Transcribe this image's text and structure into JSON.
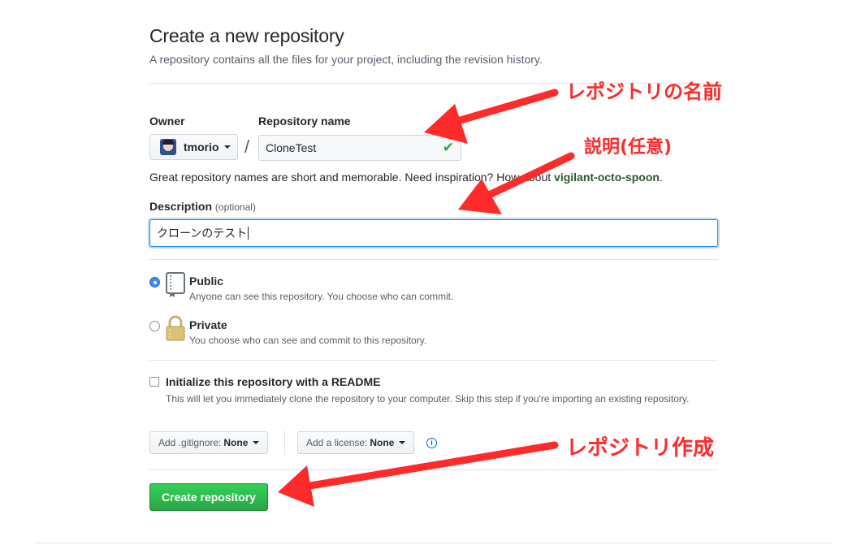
{
  "page": {
    "title": "Create a new repository",
    "subtitle": "A repository contains all the files for your project, including the revision history."
  },
  "owner": {
    "label": "Owner",
    "value": "tmorio"
  },
  "repo_name": {
    "label": "Repository name",
    "value": "CloneTest",
    "valid_icon": "check-icon"
  },
  "hint": {
    "text": "Great repository names are short and memorable. Need inspiration? How about ",
    "suggestion": "vigilant-octo-spoon",
    "end": "."
  },
  "description": {
    "label": "Description",
    "optional": "(optional)",
    "value": "クローンのテスト"
  },
  "visibility": {
    "public": {
      "title": "Public",
      "desc": "Anyone can see this repository. You choose who can commit.",
      "icon": "repo-book-icon",
      "selected": true
    },
    "private": {
      "title": "Private",
      "desc": "You choose who can see and commit to this repository.",
      "icon": "lock-icon",
      "selected": false
    }
  },
  "readme": {
    "title": "Initialize this repository with a README",
    "desc": "This will let you immediately clone the repository to your computer. Skip this step if you're importing an existing repository.",
    "checked": false
  },
  "gitignore": {
    "label": "Add .gitignore:",
    "value": "None"
  },
  "license": {
    "label": "Add a license:",
    "value": "None"
  },
  "submit": {
    "label": "Create repository"
  },
  "annotations": {
    "repo_name": "レポジトリの名前",
    "description": "説明(任意)",
    "create": "レポジトリ作成"
  },
  "colors": {
    "accent_blue": "#0366d6",
    "create_green": "#28a745",
    "annotation_red": "#ff2a2a",
    "suggestion_green": "#2b5a2e"
  }
}
